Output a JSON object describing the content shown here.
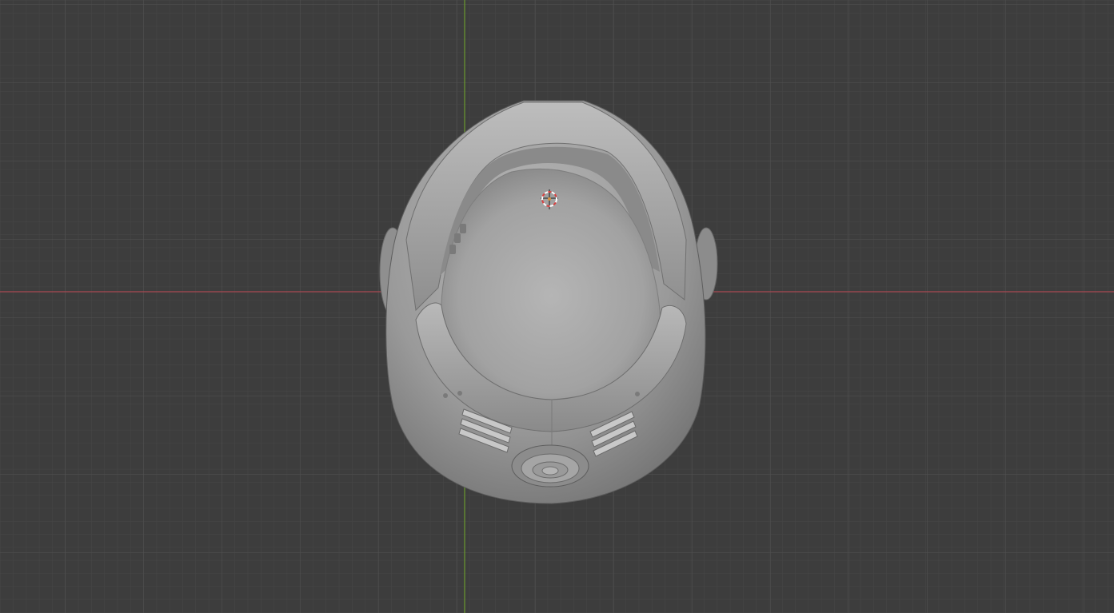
{
  "app": {
    "name": "",
    "view": "3d-viewport"
  },
  "viewport": {
    "background_color": "#3d3d3d",
    "grid": {
      "visible": true,
      "minor_color": "#454545",
      "major_color": "#505050"
    },
    "axes": {
      "x_axis_color": "#a84a52",
      "y_axis_color": "#6a9a30"
    },
    "cursor": {
      "icon": "3d-cursor-icon",
      "colors": [
        "#d84040",
        "#ffffff"
      ]
    },
    "object": {
      "icon": "helmet-mesh",
      "shade_color": "#9a9a9a"
    }
  }
}
